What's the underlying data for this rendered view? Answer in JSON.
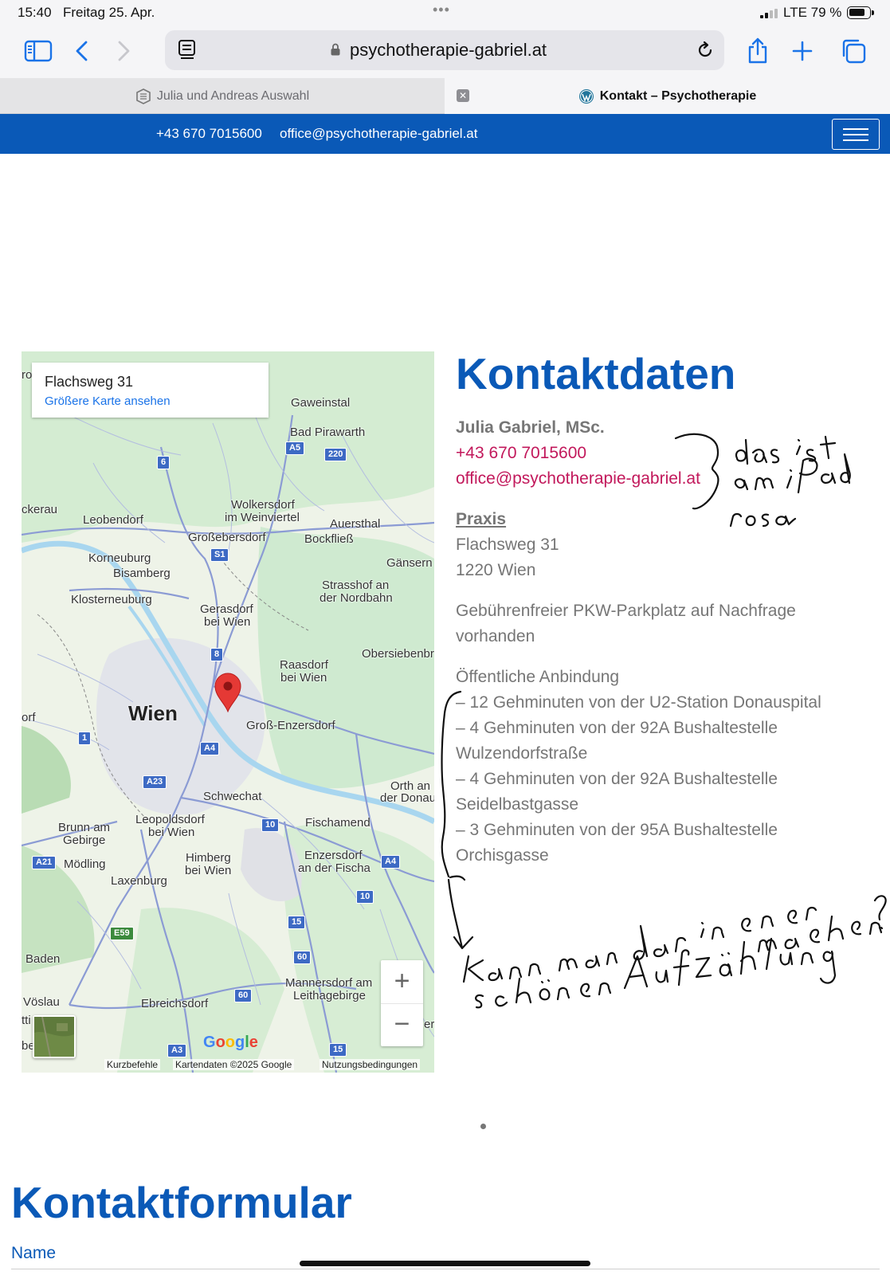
{
  "status_bar": {
    "time": "15:40",
    "date": "Freitag 25. Apr.",
    "network": "LTE",
    "battery": "79 %",
    "battery_level": 0.79
  },
  "browser": {
    "url": "psychotherapie-gabriel.at",
    "tabs": [
      {
        "label": "Julia und Andreas Auswahl",
        "active": false
      },
      {
        "label": "Kontakt – Psychotherapie",
        "active": true
      }
    ]
  },
  "site": {
    "topbar": {
      "phone": "+43 670 7015600",
      "email": "office@psychotherapie-gabriel.at"
    },
    "accent_color": "#0a59b7"
  },
  "map": {
    "place_title": "Flachsweg 31",
    "larger_map_link": "Größere Karte ansehen",
    "zoom_in": "+",
    "zoom_out": "−",
    "google_logo": "Google",
    "footer": {
      "shortcuts": "Kurzbefehle",
      "mapdata": "Kartendaten ©2025 Google",
      "terms": "Nutzungsbedingungen"
    },
    "labels": {
      "ro": "ro",
      "gaweinstal": "Gaweinstal",
      "bad_pirawarth": "Bad Pirawarth",
      "ckerau": "ckerau",
      "leobendorf": "Leobendorf",
      "wolkersdorf": "Wolkersdorf",
      "im_weinviertel": "im Weinviertel",
      "auersthal": "Auersthal",
      "grossebersdorf": "Großebersdorf",
      "bockfliess": "Bockfließ",
      "korneuburg": "Korneuburg",
      "bisamberg": "Bisamberg",
      "gaensern": "Gänsern",
      "strasshof": "Strasshof an",
      "der_nordbahn": "der Nordbahn",
      "klosterneuburg": "Klosterneuburg",
      "gerasdorf": "Gerasdorf",
      "bei_wien": "bei Wien",
      "obersiebenbr": "Obersiebenbr",
      "raasdorf": "Raasdorf",
      "raasdorf_bei_wien": "bei Wien",
      "wien": "Wien",
      "orf": "orf",
      "gross_enzersdorf": "Groß-Enzersdorf",
      "orth": "Orth an",
      "der_donau": "der Donau",
      "schwechat": "Schwechat",
      "brunn": "Brunn am",
      "gebirge": "Gebirge",
      "leopoldsdorf": "Leopoldsdorf",
      "leopoldsdorf_bei_wien": "bei Wien",
      "fischamend": "Fischamend",
      "moedling": "Mödling",
      "himberg": "Himberg",
      "himberg_bei_wien": "bei Wien",
      "enzersdorf": "Enzersdorf",
      "an_der_fischa": "an der Fischa",
      "laxenburg": "Laxenburg",
      "baden": "Baden",
      "mannersdorf": "Mannersdorf am",
      "leithagebirge": "Leithagebirge",
      "voeslau": "Vöslau",
      "ebreichsdorf": "Ebreichsdorf",
      "tti": "tti",
      "be": "be",
      "er": "er"
    },
    "shields": {
      "a5": "A5",
      "r220": "220",
      "r6": "6",
      "s1": "S1",
      "r8": "8",
      "r1": "1",
      "a4a": "A4",
      "a23": "A23",
      "r10a": "10",
      "a21": "A21",
      "a4b": "A4",
      "r10b": "10",
      "r15a": "15",
      "e59": "E59",
      "r60a": "60",
      "r60b": "60",
      "a3": "A3",
      "r15b": "15"
    }
  },
  "contact": {
    "title": "Kontaktdaten",
    "name": "Julia Gabriel, MSc.",
    "phone": "+43 670 7015600",
    "email": "office@psychotherapie-gabriel.at",
    "practice_heading": "Praxis",
    "street": "Flachsweg 31",
    "city": "1220 Wien",
    "parking_1": "Gebührenfreier PKW-Parkplatz auf Nachfrage",
    "parking_2": "vorhanden",
    "transit_heading": "Öffentliche Anbindung",
    "transit_lines": [
      "– 12 Gehminuten von der U2-Station Donauspital",
      "– 4 Gehminuten von der 92A Bushaltestelle",
      "Wulzendorfstraße",
      "– 4 Gehminuten von der 92A Bushaltestelle",
      "Seidelbastgasse",
      "– 3 Gehminuten von der 95A Bushaltestelle",
      "Orchisgasse"
    ],
    "link_color": "#c2185b"
  },
  "annotations": {
    "note_1": "das ist am iPad rosa",
    "note_2": "Kann man das in einer schönen Aufzählung machen?"
  },
  "form": {
    "title": "Kontaktformular",
    "name_label": "Name"
  }
}
